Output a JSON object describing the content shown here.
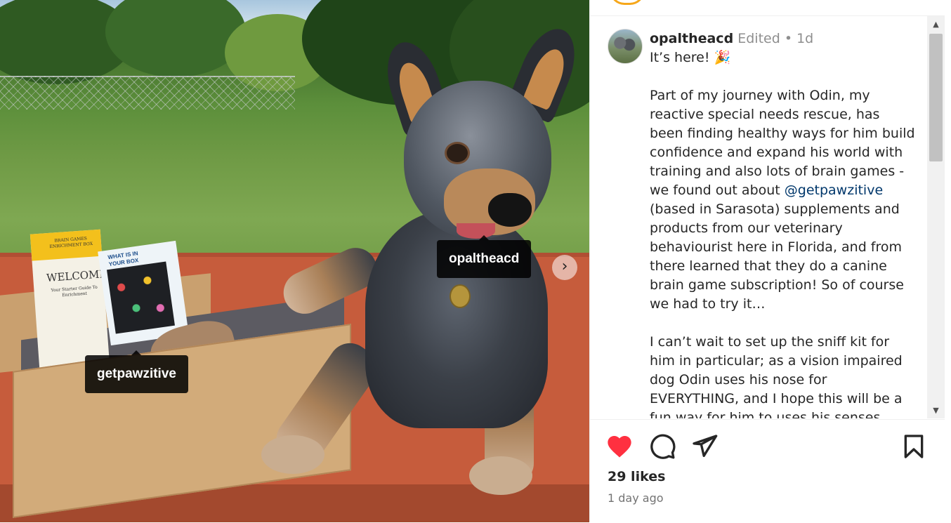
{
  "post": {
    "username": "opaltheacd",
    "edited_label": "Edited",
    "separator": "•",
    "age_short": "1d",
    "caption_first_line": "It’s here! 🎉",
    "paragraph_1_before_mention": "Part of my journey with Odin, my reactive special needs rescue, has been finding healthy ways for him build confidence and expand his world with training and also lots of brain games - we found out about ",
    "mention": "@getpawzitive",
    "paragraph_1_after_mention": " (based in Sarasota) supplements and products from our veterinary behaviourist here in Florida, and from there learned that they do a canine brain game subscription! So of course we had to try it…",
    "paragraph_2": "I can’t wait to set up the sniff kit for him in particular; as a vision impaired dog Odin uses his nose for EVERYTHING, and I hope this will be a fun way for him to uses his senses…",
    "likes": "29 likes",
    "time_ago": "1 day ago"
  },
  "media": {
    "tags": [
      {
        "label": "opaltheacd"
      },
      {
        "label": "getpawzitive"
      }
    ],
    "next_icon": "chevron-right-icon",
    "box_card_title": "BRAIN GAMES ENRICHMENT BOX",
    "box_card_welcome": "WELCOME",
    "box_card_sub": "Your Starter Guide To Enrichment",
    "insert_card_title": "WHAT IS IN YOUR BOX"
  },
  "icons": {
    "like": "heart-icon",
    "comment": "comment-icon",
    "share": "send-icon",
    "save": "bookmark-icon"
  },
  "colors": {
    "like_red": "#ff3040",
    "mention_blue": "#00376b",
    "story_ring": "#f6a71a",
    "muted_text": "#8e8e8e"
  }
}
